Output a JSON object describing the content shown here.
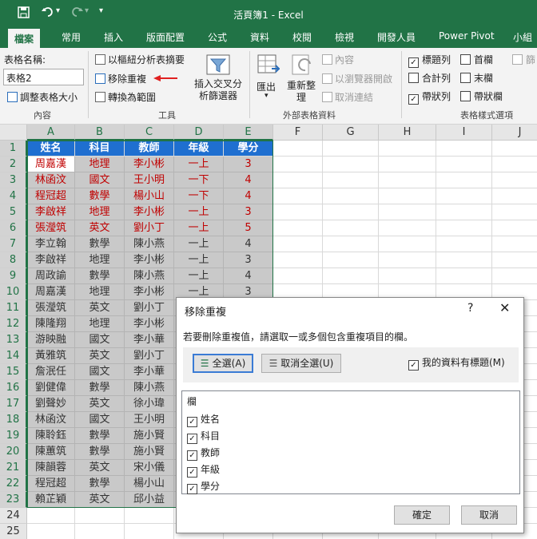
{
  "window": {
    "title": "活頁簿1 - Excel"
  },
  "qat": {
    "save_icon": "save-icon",
    "undo_icon": "undo-icon",
    "redo_icon": "redo-icon",
    "more": "▾"
  },
  "tabs": [
    "檔案",
    "常用",
    "插入",
    "版面配置",
    "公式",
    "資料",
    "校閱",
    "檢視",
    "開發人員",
    "Power Pivot",
    "小組"
  ],
  "ribbon": {
    "table_name_label": "表格名稱:",
    "table_name_value": "表格2",
    "resize_table": "調整表格大小",
    "group_properties": "內容",
    "summarize_pivot": "以樞紐分析表摘要",
    "remove_duplicates": "移除重複",
    "convert_range": "轉換為範圍",
    "insert_slicer": "插入交叉分析篩選器",
    "group_tools": "工具",
    "export": "匯出",
    "refresh": "重新整理",
    "properties": "內容",
    "open_browser": "以瀏覽器開啟",
    "unlink": "取消連結",
    "group_external": "外部表格資料",
    "header_row": "標題列",
    "total_row": "合計列",
    "banded_rows": "帶狀列",
    "first_column": "首欄",
    "last_column": "末欄",
    "banded_columns": "帶狀欄",
    "filter_button": "篩",
    "group_styles": "表格樣式選項",
    "header_row_checked": true,
    "total_row_checked": false,
    "banded_rows_checked": true,
    "first_column_checked": false,
    "last_column_checked": false,
    "banded_columns_checked": false
  },
  "grid": {
    "columns": [
      "A",
      "B",
      "C",
      "D",
      "E",
      "F",
      "G",
      "H",
      "I",
      "J"
    ],
    "rows": [
      "1",
      "2",
      "3",
      "4",
      "5",
      "6",
      "7",
      "8",
      "9",
      "10",
      "11",
      "12",
      "13",
      "14",
      "15",
      "16",
      "17",
      "18",
      "19",
      "20",
      "21",
      "22",
      "23",
      "24",
      "25"
    ],
    "header": [
      "姓名",
      "科目",
      "教師",
      "年級",
      "學分"
    ],
    "data": [
      [
        "周嘉漢",
        "地理",
        "李小彬",
        "一上",
        "3"
      ],
      [
        "林函汶",
        "國文",
        "王小明",
        "一下",
        "4"
      ],
      [
        "程冠超",
        "數學",
        "楊小山",
        "一下",
        "4"
      ],
      [
        "李啟祥",
        "地理",
        "李小彬",
        "一上",
        "3"
      ],
      [
        "張瀅筑",
        "英文",
        "劉小丁",
        "一上",
        "5"
      ],
      [
        "李立翰",
        "數學",
        "陳小燕",
        "一上",
        "4"
      ],
      [
        "李啟祥",
        "地理",
        "李小彬",
        "一上",
        "3"
      ],
      [
        "周政諭",
        "數學",
        "陳小燕",
        "一上",
        "4"
      ],
      [
        "周嘉漢",
        "地理",
        "李小彬",
        "一上",
        "3"
      ],
      [
        "張瀅筑",
        "英文",
        "劉小丁",
        "",
        ""
      ],
      [
        "陳隆翔",
        "地理",
        "李小彬",
        "",
        ""
      ],
      [
        "游映融",
        "國文",
        "李小華",
        "",
        ""
      ],
      [
        "黃雅筑",
        "英文",
        "劉小丁",
        "",
        ""
      ],
      [
        "詹泯任",
        "國文",
        "李小華",
        "",
        ""
      ],
      [
        "劉健偉",
        "數學",
        "陳小燕",
        "",
        ""
      ],
      [
        "劉聲妙",
        "英文",
        "徐小瑋",
        "",
        ""
      ],
      [
        "林函汶",
        "國文",
        "王小明",
        "",
        ""
      ],
      [
        "陳聆鈺",
        "數學",
        "施小賢",
        "",
        ""
      ],
      [
        "陳蕙筑",
        "數學",
        "施小賢",
        "",
        ""
      ],
      [
        "陳韻蓉",
        "英文",
        "宋小儀",
        "",
        ""
      ],
      [
        "程冠超",
        "數學",
        "楊小山",
        "",
        ""
      ],
      [
        "賴芷穎",
        "英文",
        "邱小益",
        "",
        ""
      ]
    ]
  },
  "dialog": {
    "title": "移除重複",
    "help": "?",
    "close": "✕",
    "instruction": "若要刪除重複值，請選取一或多個包含重複項目的欄。",
    "select_all": "全選(A)",
    "unselect_all": "取消全選(U)",
    "my_data_has_headers": "我的資料有標題(M)",
    "headers_checked": true,
    "columns_label": "欄",
    "columns": [
      {
        "name": "姓名",
        "checked": true
      },
      {
        "name": "科目",
        "checked": true
      },
      {
        "name": "教師",
        "checked": true
      },
      {
        "name": "年級",
        "checked": true
      },
      {
        "name": "學分",
        "checked": true
      }
    ],
    "ok": "確定",
    "cancel": "取消"
  }
}
